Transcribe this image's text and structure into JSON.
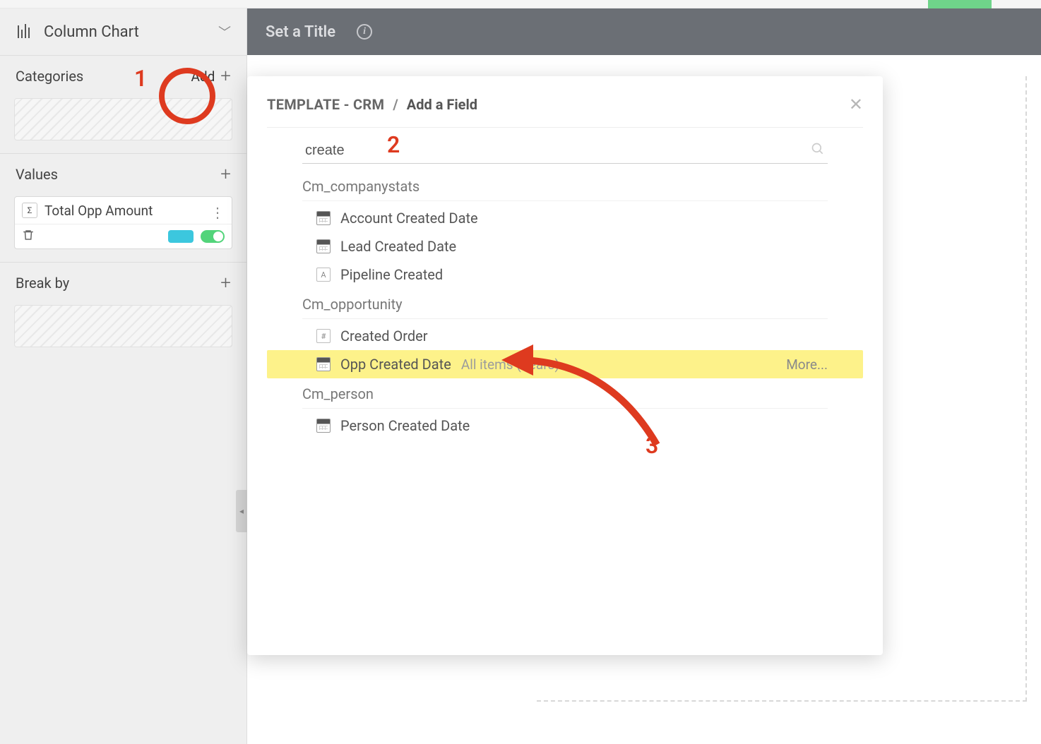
{
  "sidebar": {
    "chart_type_label": "Column Chart",
    "sections": {
      "categories": {
        "title": "Categories",
        "add_label": "Add"
      },
      "values": {
        "title": "Values",
        "chip_label": "Total Opp Amount"
      },
      "break_by": {
        "title": "Break by"
      }
    }
  },
  "header": {
    "title_placeholder": "Set a Title"
  },
  "popover": {
    "breadcrumb_source": "TEMPLATE - CRM",
    "breadcrumb_title": "Add a Field",
    "search_value": "create",
    "groups": [
      {
        "name": "Cm_companystats",
        "fields": [
          {
            "type": "calendar",
            "label": "Account Created Date"
          },
          {
            "type": "calendar",
            "label": "Lead Created Date"
          },
          {
            "type": "text",
            "label": "Pipeline Created"
          }
        ]
      },
      {
        "name": "Cm_opportunity",
        "fields": [
          {
            "type": "number",
            "label": "Created Order"
          },
          {
            "type": "calendar",
            "label": "Opp Created Date",
            "extra": "All items (Years)",
            "highlight": true,
            "more": "More..."
          }
        ]
      },
      {
        "name": "Cm_person",
        "fields": [
          {
            "type": "calendar",
            "label": "Person Created Date"
          }
        ]
      }
    ]
  },
  "annotations": {
    "one": "1",
    "two": "2",
    "three": "3"
  }
}
